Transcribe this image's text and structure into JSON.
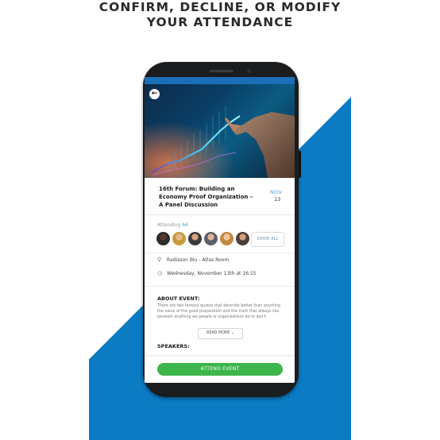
{
  "headline": {
    "line1": "CONFIRM, DECLINE, OR MODIFY",
    "line2": "YOUR ATTENDANCE"
  },
  "colors": {
    "brand_blue": "#0b7bc3",
    "accent_blue": "#4aa0d6",
    "attend_green": "#3cb54a"
  },
  "event": {
    "title": "16th Forum: Building an Economy Proof Organization – A Panel Discussion",
    "date_month": "NOV",
    "date_day": "13"
  },
  "attendance": {
    "label": "Attending",
    "count": "64",
    "show_all_label": "SHOW ALL"
  },
  "location": {
    "icon": "map-pin-icon",
    "text": "Radisson Blu - Atlas Room"
  },
  "datetime": {
    "icon": "clock-icon",
    "text": "Wednesday, November 13th at 16:15"
  },
  "about": {
    "label": "ABOUT EVENT:",
    "text": "There are two famous quotes that describe better than anything the value of the good preparation and the truth that always lies beneath anything we people or organizations do or don't.",
    "read_more_label": "READ MORE"
  },
  "speakers": {
    "label": "SPEAKERS:"
  },
  "attend_button_label": "ATTEND EVENT"
}
